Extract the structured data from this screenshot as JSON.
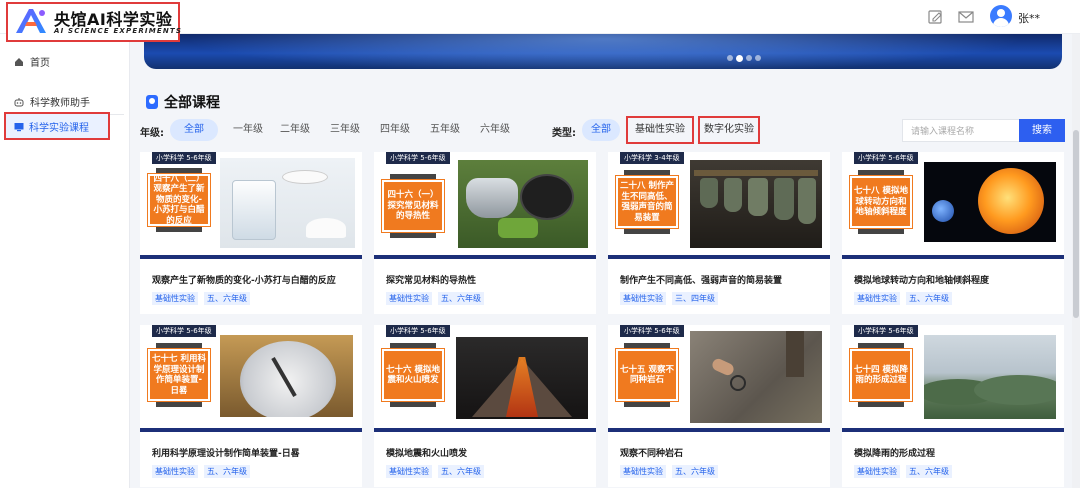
{
  "header": {
    "logo_title": "央馆AI科学实验",
    "logo_subtitle": "AI SCIENCE EXPERIMENTS",
    "username": "张**",
    "icons": [
      "edit-icon",
      "mail-icon",
      "user-avatar-icon"
    ]
  },
  "sidebar": {
    "items": [
      {
        "label": "首页",
        "icon": "home-icon"
      },
      {
        "label": "科学教师助手",
        "icon": "robot-icon"
      },
      {
        "label": "科学实验课程",
        "icon": "monitor-icon",
        "active": true
      }
    ]
  },
  "banner": {
    "slides": 4,
    "active_slide": 2
  },
  "section": {
    "title": "全部课程"
  },
  "filters": {
    "grade_label": "年级:",
    "grades": [
      "全部",
      "一年级",
      "二年级",
      "三年级",
      "四年级",
      "五年级",
      "六年级"
    ],
    "type_label": "类型:",
    "types": [
      "全部",
      "基础性实验",
      "数字化实验"
    ]
  },
  "search": {
    "placeholder": "请输入课程名称",
    "button_label": "搜索"
  },
  "courses": [
    {
      "tag": "小学科学 5-6年级",
      "badge": "四十八（二）观察产生了新物质的变化-小苏打与白醋的反应",
      "title": "观察产生了新物质的变化-小苏打与白醋的反应",
      "type": "基础性实验",
      "grade": "五、六年级"
    },
    {
      "tag": "小学科学 5-6年级",
      "badge": "四十六（一）探究常见材料的导热性",
      "title": "探究常见材料的导热性",
      "type": "基础性实验",
      "grade": "五、六年级"
    },
    {
      "tag": "小学科学 3-4年级",
      "badge": "二十八 制作产生不同高低、强弱声音的简易装置",
      "title": "制作产生不同高低、强弱声音的简易装置",
      "type": "基础性实验",
      "grade": "三、四年级"
    },
    {
      "tag": "小学科学 5-6年级",
      "badge": "七十八 模拟地球转动方向和地轴倾斜程度",
      "title": "模拟地球转动方向和地轴倾斜程度",
      "type": "基础性实验",
      "grade": "五、六年级"
    },
    {
      "tag": "小学科学 5-6年级",
      "badge": "七十七 利用科学原理设计制作简单装置-日晷",
      "title": "利用科学原理设计制作简单装置-日晷",
      "type": "基础性实验",
      "grade": "五、六年级"
    },
    {
      "tag": "小学科学 5-6年级",
      "badge": "七十六 模拟地震和火山喷发",
      "title": "模拟地震和火山喷发",
      "type": "基础性实验",
      "grade": "五、六年级"
    },
    {
      "tag": "小学科学 5-6年级",
      "badge": "七十五 观察不同种岩石",
      "title": "观察不同种岩石",
      "type": "基础性实验",
      "grade": "五、六年级"
    },
    {
      "tag": "小学科学 5-6年级",
      "badge": "七十四 模拟降雨的形成过程",
      "title": "模拟降雨的形成过程",
      "type": "基础性实验",
      "grade": "五、六年级"
    }
  ],
  "colors": {
    "accent": "#2d5ff0",
    "active_bg": "#dbe8ff",
    "badge_orange": "#f07a1f",
    "highlight_border": "#e03b3b",
    "card_bar": "#1c2f78"
  }
}
